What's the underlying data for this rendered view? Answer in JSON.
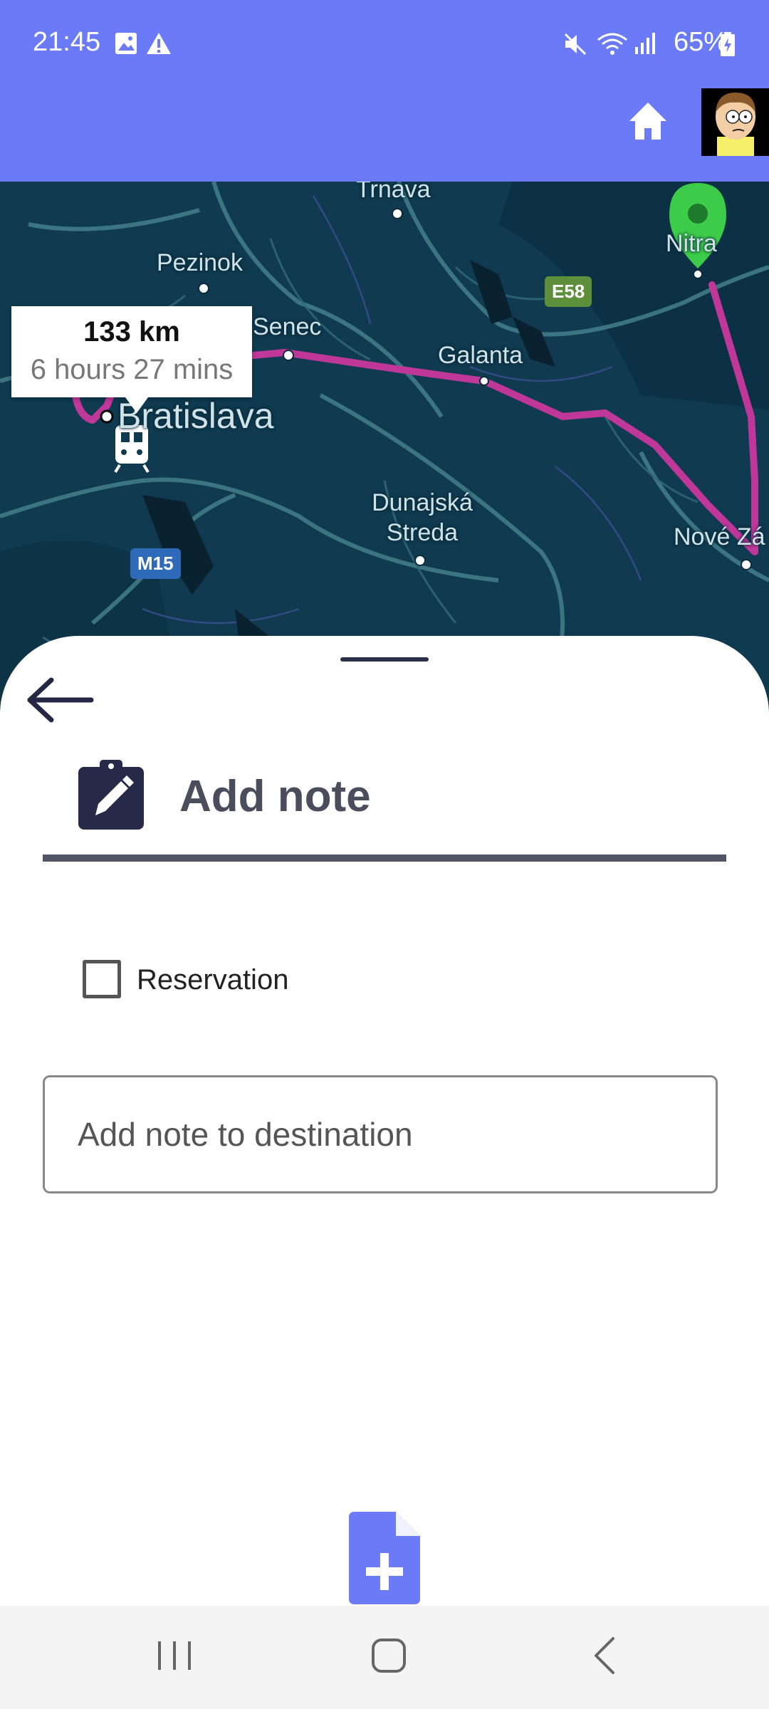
{
  "status_bar": {
    "time": "21:45",
    "battery": "65%",
    "icons": [
      "image-icon",
      "warning-icon",
      "mute-icon",
      "wifi-icon",
      "signal-icon",
      "battery-charging-icon"
    ]
  },
  "app_bar": {
    "home_icon": "home-icon",
    "avatar": "user-avatar",
    "color": "#6b7bf7"
  },
  "map": {
    "places": [
      "Trnava",
      "Pezinok",
      "Senec",
      "Galanta",
      "Bratislava",
      "Dunajská Streda",
      "Nitra",
      "Nové Zá"
    ],
    "road_shields": [
      "E58",
      "M15"
    ],
    "route_info": {
      "distance": "133 km",
      "duration": "6 hours 27 mins"
    },
    "route_color": "#c0379a",
    "destination_pin_color": "#3dcc4a"
  },
  "sheet": {
    "title": "Add note",
    "reservation_label": "Reservation",
    "reservation_checked": false,
    "note_placeholder": "Add note to destination",
    "note_value": ""
  },
  "nav_bar": {
    "recent": "recent-apps-icon",
    "home": "home-nav-icon",
    "back": "back-nav-icon"
  }
}
